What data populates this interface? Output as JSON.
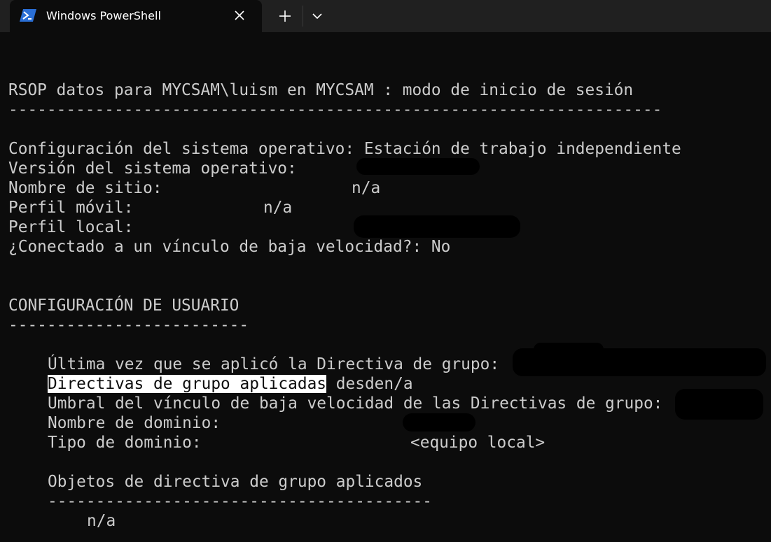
{
  "window": {
    "tab_title": "Windows PowerShell",
    "tab_icon": "powershell-icon",
    "close_icon": "close-icon",
    "new_tab_icon": "plus-icon",
    "dropdown_icon": "chevron-down-icon"
  },
  "terminal": {
    "header": "RSOP datos para MYCSAM\\luism en MYCSAM : modo de inicio de sesión",
    "header_rule": "--------------------------------------------------------------------",
    "os_config_label": "Configuración del sistema operativo:",
    "os_config_value": "Estación de trabajo independiente",
    "os_version_label": "Versión del sistema operativo:",
    "site_name_label": "Nombre de sitio:",
    "site_name_value": "n/a",
    "roaming_profile_label": "Perfil móvil:",
    "roaming_profile_value": "n/a",
    "local_profile_label": "Perfil local:",
    "slow_link_label": "¿Conectado a un vínculo de baja velocidad?:",
    "slow_link_value": "No",
    "user_config_title": "CONFIGURACIÓN DE USUARIO",
    "user_config_rule": "-------------------------",
    "last_applied_label": "Última vez que se aplicó la Directiva de grupo:",
    "applied_from_label": "Directivas de grupo aplicadas",
    "applied_from_value": "desden/a",
    "threshold_label": "Umbral del vínculo de baja velocidad de las Directivas de grupo:",
    "domain_name_label": "Nombre de dominio:",
    "domain_type_label": "Tipo de dominio:",
    "domain_type_value": "<equipo local>",
    "gpo_title": "Objetos de directiva de grupo aplicados",
    "gpo_rule": "----------------------------------------",
    "gpo_value": "n/a"
  }
}
